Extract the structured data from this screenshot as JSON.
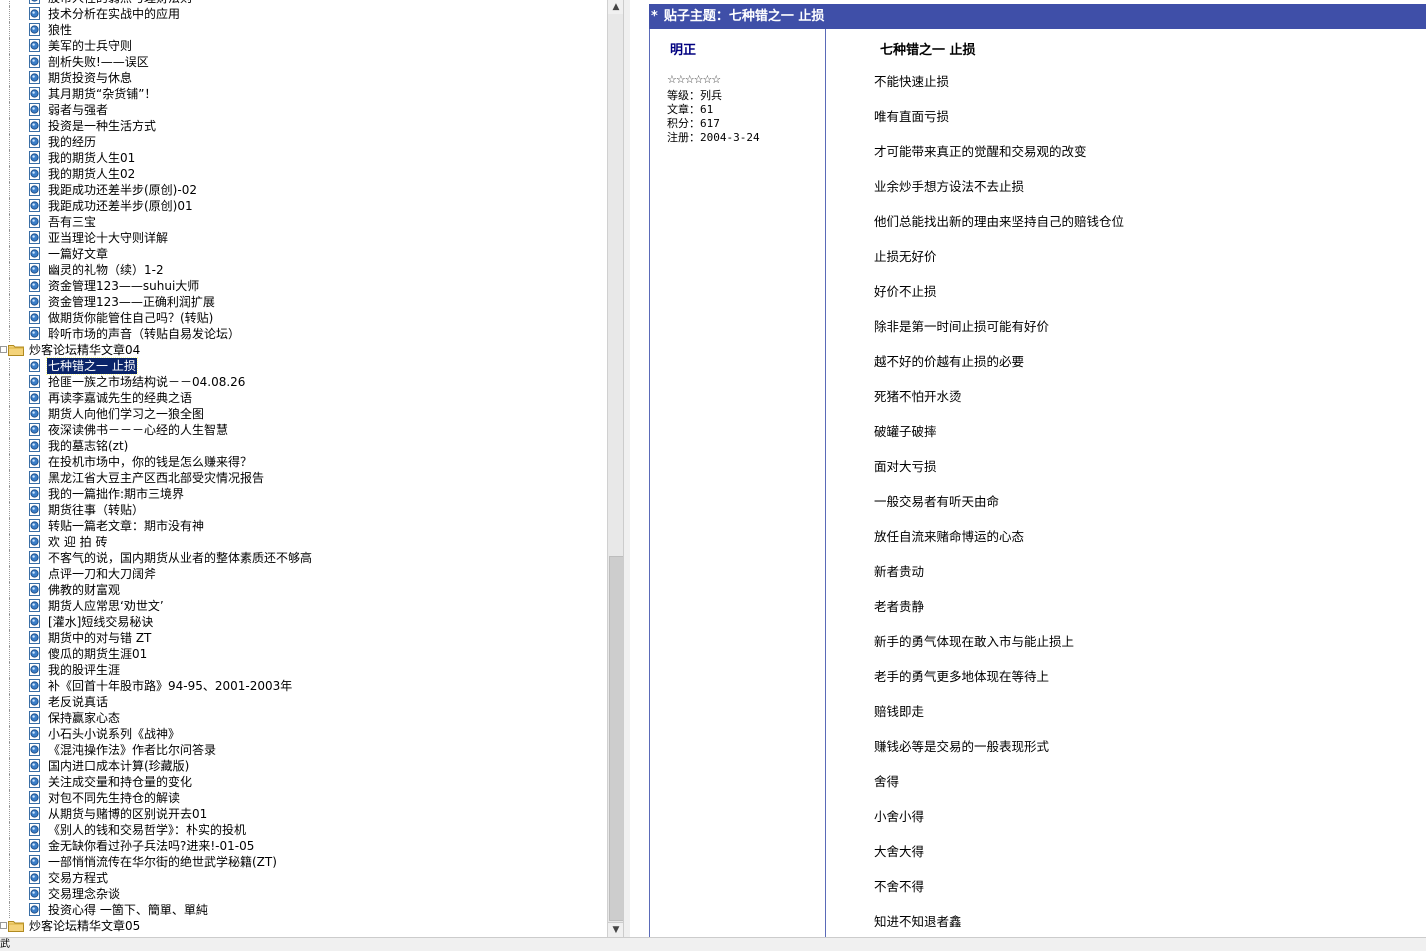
{
  "tree": {
    "items": [
      {
        "type": "leaf",
        "label": "股市人性的弱点与理财法则"
      },
      {
        "type": "leaf",
        "label": "技术分析在实战中的应用"
      },
      {
        "type": "leaf",
        "label": "狼性"
      },
      {
        "type": "leaf",
        "label": "美军的士兵守则"
      },
      {
        "type": "leaf",
        "label": "剖析失败!——误区"
      },
      {
        "type": "leaf",
        "label": "期货投资与休息"
      },
      {
        "type": "leaf",
        "label": "其月期货“杂货铺”！"
      },
      {
        "type": "leaf",
        "label": "弱者与强者"
      },
      {
        "type": "leaf",
        "label": "投资是一种生活方式"
      },
      {
        "type": "leaf",
        "label": "我的经历"
      },
      {
        "type": "leaf",
        "label": "我的期货人生01"
      },
      {
        "type": "leaf",
        "label": "我的期货人生02"
      },
      {
        "type": "leaf",
        "label": "我距成功还差半步(原创)-02"
      },
      {
        "type": "leaf",
        "label": "我距成功还差半步(原创)01"
      },
      {
        "type": "leaf",
        "label": "吾有三宝"
      },
      {
        "type": "leaf",
        "label": "亚当理论十大守则详解"
      },
      {
        "type": "leaf",
        "label": "一篇好文章"
      },
      {
        "type": "leaf",
        "label": "幽灵的礼物（续）1-2"
      },
      {
        "type": "leaf",
        "label": "资金管理123——suhui大师"
      },
      {
        "type": "leaf",
        "label": "资金管理123——正确利润扩展"
      },
      {
        "type": "leaf",
        "label": "做期货你能管住自己吗？(转贴)"
      },
      {
        "type": "leaf",
        "label": "聆听市场的声音（转贴自易发论坛）"
      },
      {
        "type": "folder",
        "label": "炒客论坛精华文章04"
      },
      {
        "type": "leaf",
        "label": "七种错之一 止损",
        "selected": true
      },
      {
        "type": "leaf",
        "label": "抢匪一族之市场结构说－－04.08.26"
      },
      {
        "type": "leaf",
        "label": "再读李嘉诚先生的经典之语"
      },
      {
        "type": "leaf",
        "label": "期货人向他们学习之一狼全图"
      },
      {
        "type": "leaf",
        "label": "夜深读佛书－－－心经的人生智慧"
      },
      {
        "type": "leaf",
        "label": "我的墓志铭(zt)"
      },
      {
        "type": "leaf",
        "label": "在投机市场中，你的钱是怎么赚来得？"
      },
      {
        "type": "leaf",
        "label": "黑龙江省大豆主产区西北部受灾情况报告"
      },
      {
        "type": "leaf",
        "label": "我的一篇拙作:期市三境界"
      },
      {
        "type": "leaf",
        "label": "期货往事（转贴）"
      },
      {
        "type": "leaf",
        "label": "转贴一篇老文章：期市没有神"
      },
      {
        "type": "leaf",
        "label": "欢 迎 拍 砖"
      },
      {
        "type": "leaf",
        "label": "不客气的说，国内期货从业者的整体素质还不够高"
      },
      {
        "type": "leaf",
        "label": "点评一刀和大刀阔斧"
      },
      {
        "type": "leaf",
        "label": "佛教的财富观"
      },
      {
        "type": "leaf",
        "label": "期货人应常思‘劝世文’"
      },
      {
        "type": "leaf",
        "label": "[灌水]短线交易秘诀"
      },
      {
        "type": "leaf",
        "label": "期货中的对与错 ZT"
      },
      {
        "type": "leaf",
        "label": "傻瓜的期货生涯01"
      },
      {
        "type": "leaf",
        "label": "我的股评生涯"
      },
      {
        "type": "leaf",
        "label": "补《回首十年股市路》94-95、2001-2003年"
      },
      {
        "type": "leaf",
        "label": "老反说真话"
      },
      {
        "type": "leaf",
        "label": "保持赢家心态"
      },
      {
        "type": "leaf",
        "label": "小石头小说系列《战神》"
      },
      {
        "type": "leaf",
        "label": "《混沌操作法》作者比尔问答录"
      },
      {
        "type": "leaf",
        "label": "国内进口成本计算(珍藏版)"
      },
      {
        "type": "leaf",
        "label": "关注成交量和持仓量的变化"
      },
      {
        "type": "leaf",
        "label": "对包不同先生持仓的解读"
      },
      {
        "type": "leaf",
        "label": "从期货与赌博的区别说开去01"
      },
      {
        "type": "leaf",
        "label": "《别人的钱和交易哲学》：朴实的投机"
      },
      {
        "type": "leaf",
        "label": "金无缺你看过孙子兵法吗?进来!-01-05"
      },
      {
        "type": "leaf",
        "label": "一部悄悄流传在华尔街的绝世武学秘籍(ZT)"
      },
      {
        "type": "leaf",
        "label": "交易方程式"
      },
      {
        "type": "leaf",
        "label": "交易理念杂谈"
      },
      {
        "type": "leaf",
        "label": "投资心得 一箇下、簡單、單純"
      },
      {
        "type": "folder",
        "label": "炒客论坛精华文章05"
      }
    ]
  },
  "post": {
    "header": "贴子主题：七种错之一 止损",
    "header_star": "*",
    "author": {
      "name": "明正",
      "stars": "☆☆☆☆☆☆",
      "level": "等级：列兵",
      "posts": "文章：61",
      "points": "积分：617",
      "registered": "注册：2004-3-24"
    },
    "title": "七种错之一 止损",
    "lines": [
      "不能快速止损",
      "唯有直面亏损",
      "才可能带来真正的觉醒和交易观的改变",
      "业余炒手想方设法不去止损",
      "他们总能找出新的理由来坚持自己的赔钱仓位",
      "止损无好价",
      "好价不止损",
      "除非是第一时间止损可能有好价",
      "越不好的价越有止损的必要",
      "死猪不怕开水烫",
      "破罐子破摔",
      "面对大亏损",
      "一般交易者有听天由命",
      "放任自流来赌命博运的心态",
      "新者贵动",
      "老者贵静",
      "新手的勇气体现在敢入市与能止损上",
      "老手的勇气更多地体现在等待上",
      "赔钱即走",
      "赚钱必等是交易的一般表现形式",
      "舍得",
      "小舍小得",
      "大舍大得",
      "不舍不得",
      "知进不知退者鑫"
    ]
  },
  "status": {
    "text": "武"
  },
  "colors": {
    "header_bg": "#3f4fa8",
    "selected_bg": "#0a246a",
    "author_name": "#000080"
  }
}
